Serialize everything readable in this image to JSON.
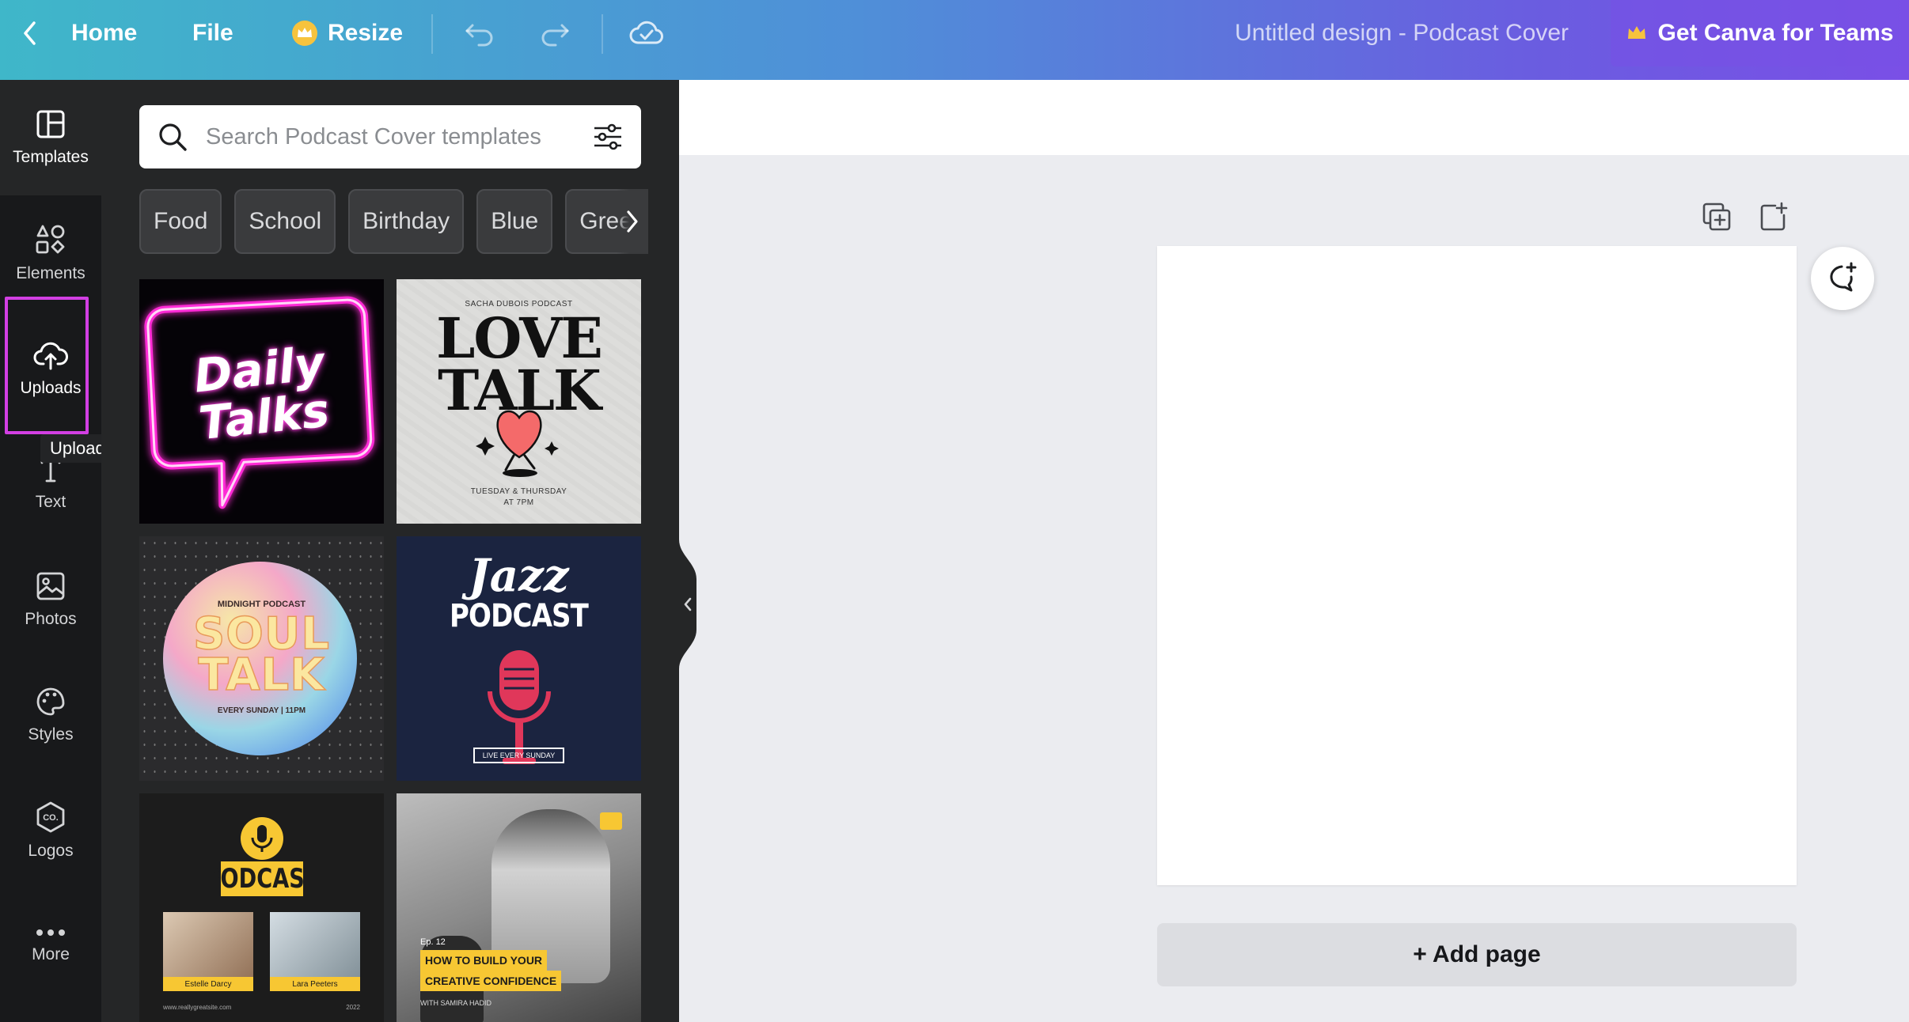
{
  "topbar": {
    "home_label": "Home",
    "file_label": "File",
    "resize_label": "Resize",
    "design_title": "Untitled design - Podcast Cover",
    "teams_label": "Get Canva for Teams"
  },
  "rail": {
    "items": [
      {
        "label": "Templates",
        "icon": "templates-icon"
      },
      {
        "label": "Elements",
        "icon": "elements-icon"
      },
      {
        "label": "Uploads",
        "icon": "upload-cloud-icon"
      },
      {
        "label": "Text",
        "icon": "text-icon"
      },
      {
        "label": "Photos",
        "icon": "photos-icon"
      },
      {
        "label": "Styles",
        "icon": "palette-icon"
      },
      {
        "label": "Logos",
        "icon": "logo-icon"
      },
      {
        "label": "More",
        "icon": "more-icon"
      }
    ],
    "tooltip": "Uploads"
  },
  "panel": {
    "search_placeholder": "Search Podcast Cover templates",
    "chips": [
      "Food",
      "School",
      "Birthday",
      "Blue",
      "Green"
    ],
    "templates": [
      {
        "name": "daily-talks",
        "lines": [
          "Daily",
          "Talks"
        ]
      },
      {
        "name": "love-talk",
        "kicker": "SACHA DUBOIS PODCAST",
        "lines": [
          "LOVE",
          "TALK"
        ],
        "footer": "TUESDAY & THURSDAY",
        "footer2": "AT 7PM"
      },
      {
        "name": "soul-talk",
        "kicker": "MIDNIGHT PODCAST",
        "lines": [
          "SOUL",
          "TALK"
        ],
        "footer": "EVERY SUNDAY | 11PM"
      },
      {
        "name": "jazz-podcast",
        "lines": [
          "Jazz",
          "PODCAST"
        ],
        "footer": "LIVE EVERY SUNDAY"
      },
      {
        "name": "podcast-guests",
        "lines": [
          "PODCAST"
        ],
        "guest1": "Estelle Darcy",
        "guest2": "Lara Peeters",
        "footer": "www.reallygreatsite.com",
        "year": "2022"
      },
      {
        "name": "creative-confidence",
        "kicker": "Ep. 12",
        "lines": [
          "HOW TO BUILD YOUR",
          "CREATIVE CONFIDENCE"
        ],
        "footer": "WITH SAMIRA HADID"
      }
    ]
  },
  "canvas": {
    "add_page_label": "+ Add page"
  },
  "colors": {
    "accent_highlight": "#d23fe3",
    "rail_bg": "#18191b",
    "panel_bg": "#252627",
    "canvas_bg": "#ebecf0"
  }
}
